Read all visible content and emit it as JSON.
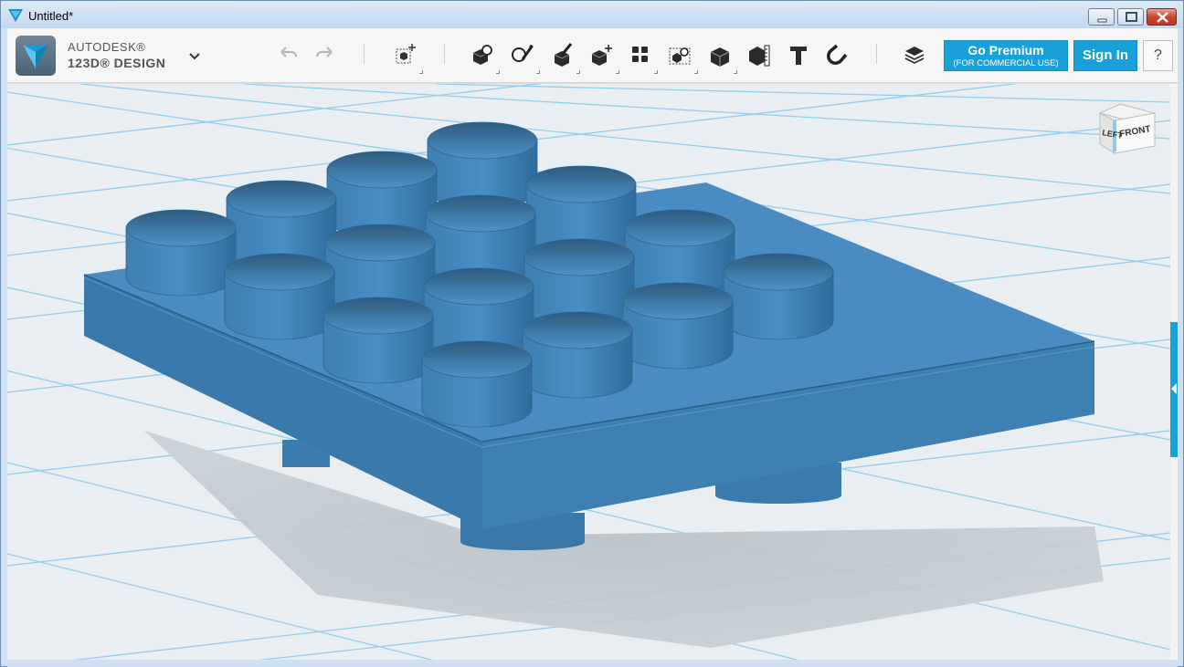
{
  "window": {
    "title": "Untitled*"
  },
  "brand": {
    "line1": "AUTODESK®",
    "line2": "123D® DESIGN"
  },
  "toolbar": {
    "icons": [
      "undo-icon",
      "redo-icon",
      "transform-icon",
      "primitives-icon",
      "sketch-icon",
      "construct-icon",
      "modify-icon",
      "pattern-icon",
      "group-icon",
      "combine-icon",
      "measure-icon",
      "text-icon",
      "snap-icon",
      "materials-icon"
    ],
    "premium_line1": "Go Premium",
    "premium_line2": "(FOR COMMERCIAL USE)",
    "signin_label": "Sign In",
    "help_label": "?"
  },
  "viewcube": {
    "left_face": "LEFT",
    "front_face": "FRONT"
  },
  "colors": {
    "model_blue": "#3b7fb3",
    "accent": "#1aa0d8",
    "grid_line": "#7ec3e6",
    "viewport_bg": "#e8eef2"
  }
}
